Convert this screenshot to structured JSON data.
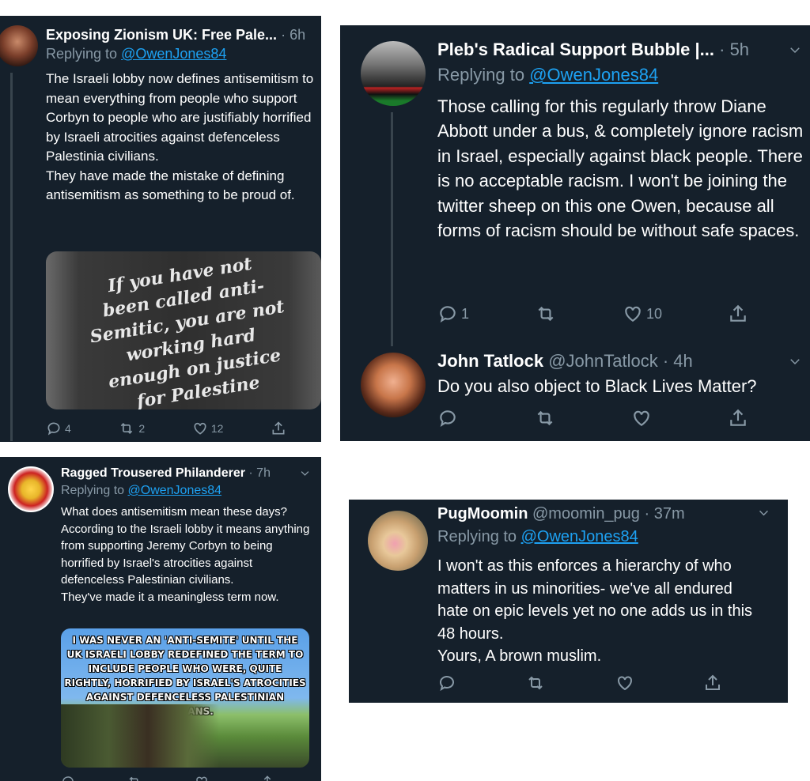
{
  "tweets": [
    {
      "name": "Exposing Zionism UK: Free Pale...",
      "time": "· 6h",
      "replying_prefix": "Replying to",
      "replying_to": "@OwenJones84",
      "text": "The Israeli lobby now defines antisemitism to mean everything from people who support Corbyn to people who are justifiably horrified by Israeli atrocities against defenceless Palestinia civilians.\nThey have made the mistake of defining antisemitism as something to be proud of.",
      "image_text": "If you have not been called anti-Semitic, you are not working hard enough on justice for Palestine",
      "replies": "4",
      "retweets": "2",
      "likes": "12"
    },
    {
      "name": "Pleb's Radical Support Bubble |...",
      "time": "· 5h",
      "replying_prefix": "Replying to",
      "replying_to": "@OwenJones84",
      "text": "Those calling for this regularly throw Diane Abbott under a bus, & completely ignore racism in Israel, especially against black people. There is no acceptable racism. I won't be joining the twitter sheep on this one Owen, because all forms of racism should be without safe spaces.",
      "replies": "1",
      "retweets": "",
      "likes": "10"
    },
    {
      "name": "John Tatlock",
      "handle": "@JohnTatlock",
      "time": "· 4h",
      "text": "Do you also object to Black Lives Matter?"
    },
    {
      "name": "Ragged Trousered Philanderer",
      "time": "· 7h",
      "replying_prefix": "Replying to",
      "replying_to": "@OwenJones84",
      "text": "What does antisemitism mean these days? According to the Israeli lobby it means anything from supporting Jeremy Corbyn to being horrified by Israel's atrocities against defenceless Palestinian civilians.\nThey've made it a meaningless term now.",
      "image_text": "I was never an 'anti-Semite' until the UK Israeli lobby redefined the term to include people who were, quite rightly, horrified by Israel's atrocities against defenceless Palestinian civilians."
    },
    {
      "name": "PugMoomin",
      "handle": "@moomin_pug",
      "time": "· 37m",
      "replying_prefix": "Replying to",
      "replying_to": "@OwenJones84",
      "text": "I won't as this enforces a hierarchy of who matters in us minorities- we've all endured hate on epic levels yet no one adds us in this 48 hours.\nYours, A brown muslim."
    }
  ],
  "icons": [
    "reply-icon",
    "retweet-icon",
    "like-icon",
    "share-icon",
    "chevron-down-icon"
  ],
  "colors": {
    "panel_bg": "#15202b",
    "link": "#1da1f2",
    "muted": "#8899a6",
    "text": "#ffffff"
  }
}
